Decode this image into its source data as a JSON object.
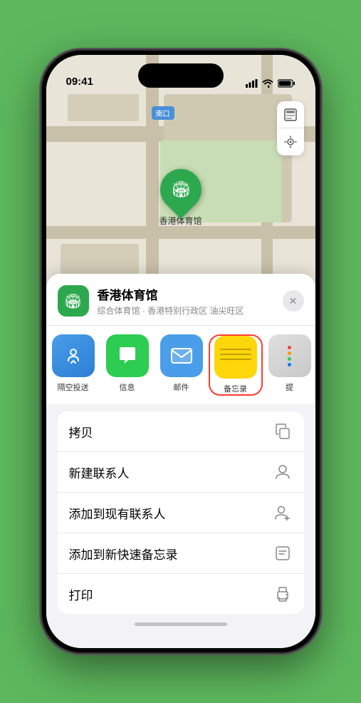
{
  "status": {
    "time": "09:41",
    "location_arrow": true
  },
  "map": {
    "label": "南口",
    "marker_label": "香港体育馆",
    "controls": [
      "map-layers",
      "location"
    ]
  },
  "location_card": {
    "name": "香港体育馆",
    "description": "综合体育馆 · 香港特别行政区 油尖旺区",
    "close_label": "✕"
  },
  "share_items": [
    {
      "id": "airdrop",
      "label": "隔空投送",
      "type": "airdrop"
    },
    {
      "id": "messages",
      "label": "信息",
      "type": "messages"
    },
    {
      "id": "mail",
      "label": "邮件",
      "type": "mail"
    },
    {
      "id": "notes",
      "label": "备忘录",
      "type": "notes",
      "selected": true
    },
    {
      "id": "more",
      "label": "提",
      "type": "more"
    }
  ],
  "actions": [
    {
      "id": "copy",
      "label": "拷贝",
      "icon": "copy"
    },
    {
      "id": "new-contact",
      "label": "新建联系人",
      "icon": "person"
    },
    {
      "id": "add-contact",
      "label": "添加到现有联系人",
      "icon": "person-add"
    },
    {
      "id": "quick-note",
      "label": "添加到新快速备忘录",
      "icon": "quick-note"
    },
    {
      "id": "print",
      "label": "打印",
      "icon": "print"
    }
  ]
}
